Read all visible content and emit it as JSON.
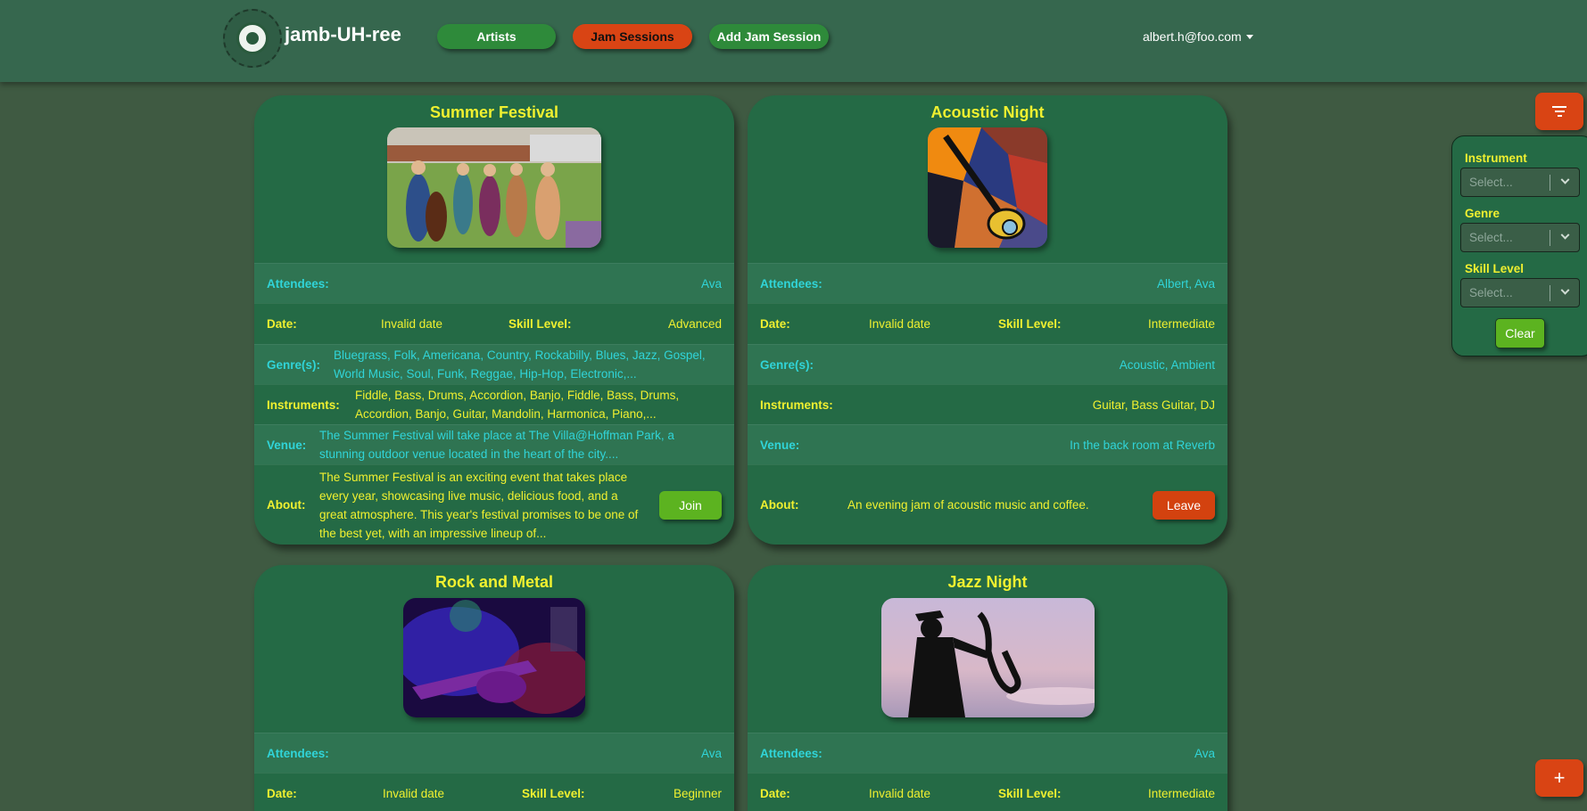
{
  "navbar": {
    "brand": "jamb-UH-ree",
    "logo_text": "JAMB-UH-REE",
    "nav": {
      "artists": "Artists",
      "jam_sessions": "Jam Sessions",
      "add_jam_session": "Add Jam Session"
    },
    "user": "albert.h@foo.com"
  },
  "labels": {
    "attendees": "Attendees:",
    "date": "Date:",
    "skill_level": "Skill Level:",
    "genres": "Genre(s):",
    "instruments": "Instruments:",
    "venue": "Venue:",
    "about": "About:"
  },
  "cards": [
    {
      "title": "Summer Festival",
      "attendees": "Ava",
      "date": "Invalid date",
      "skill_level": "Advanced",
      "genres": "Bluegrass, Folk, Americana, Country, Rockabilly, Blues, Jazz, Gospel, World Music, Soul, Funk, Reggae, Hip-Hop, Electronic,...",
      "instruments": "Fiddle, Bass, Drums, Accordion, Banjo, Fiddle, Bass, Drums, Accordion, Banjo, Guitar, Mandolin, Harmonica, Piano,...",
      "venue": "The Summer Festival will take place at The Villa@Hoffman Park, a stunning outdoor venue located in the heart of the city....",
      "about": "The Summer Festival is an exciting event that takes place every year, showcasing live music, delicious food, and a great atmosphere. This year's festival promises to be one of the best yet, with an impressive lineup of...",
      "action": "Join"
    },
    {
      "title": "Acoustic Night",
      "attendees": "Albert, Ava",
      "date": "Invalid date",
      "skill_level": "Intermediate",
      "genres": "Acoustic, Ambient",
      "instruments": "Guitar, Bass Guitar, DJ",
      "venue": "In the back room at Reverb",
      "about": "An evening jam of acoustic music and coffee.",
      "action": "Leave"
    },
    {
      "title": "Rock and Metal",
      "attendees": "Ava",
      "date": "Invalid date",
      "skill_level": "Beginner"
    },
    {
      "title": "Jazz Night",
      "attendees": "Ava",
      "date": "Invalid date",
      "skill_level": "Intermediate"
    }
  ],
  "filters": {
    "instrument_label": "Instrument",
    "genre_label": "Genre",
    "skill_label": "Skill Level",
    "placeholder": "Select...",
    "clear": "Clear"
  },
  "add_button": "+",
  "colors": {
    "accent_orange": "#d94414",
    "accent_green": "#2e8a3a",
    "card_bg": "#246a45",
    "label_yellow": "#f0f030",
    "label_cyan": "#30d4d8"
  }
}
